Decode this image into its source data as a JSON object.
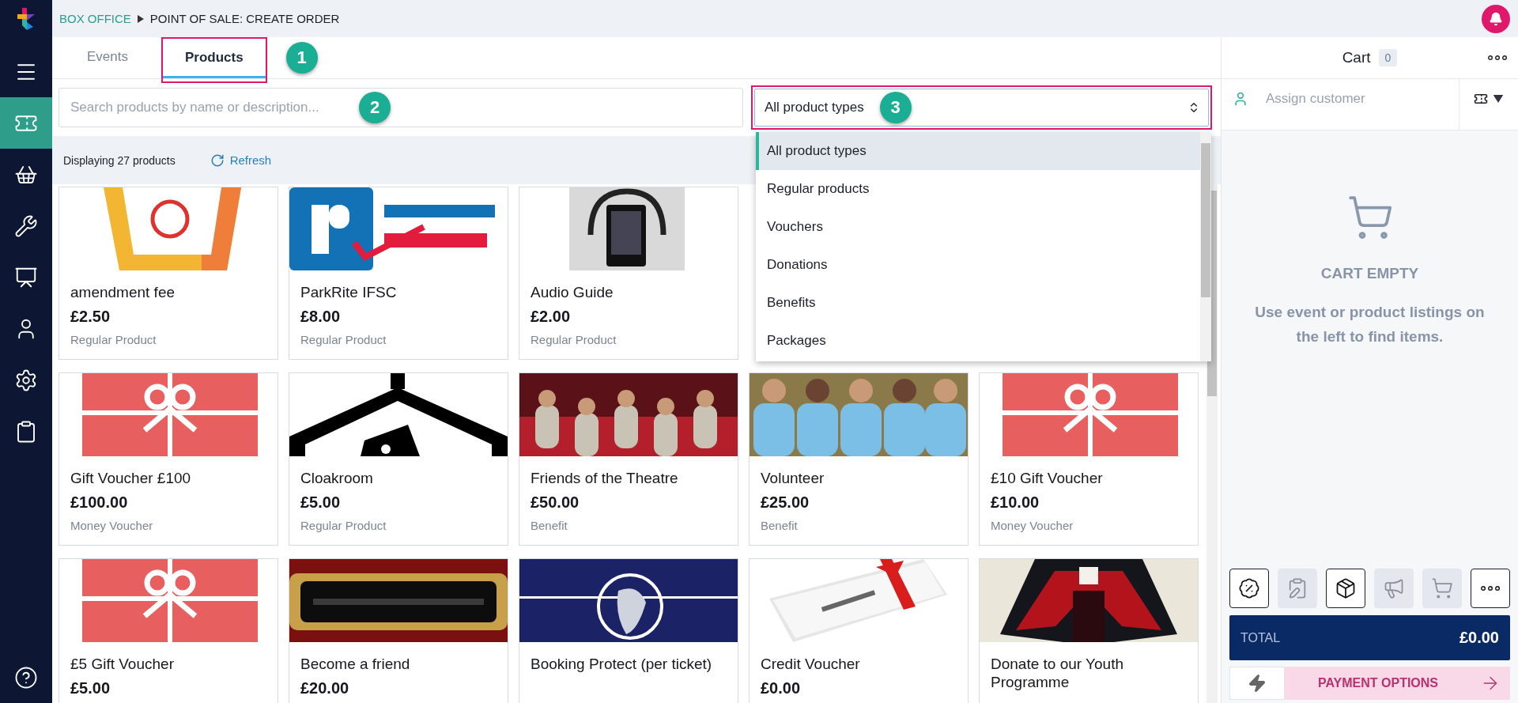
{
  "breadcrumb": {
    "section": "BOX OFFICE",
    "page": "POINT OF SALE: CREATE ORDER"
  },
  "sidebar": {
    "items": [
      {
        "selected": false
      },
      {
        "selected": true
      },
      {
        "selected": false
      },
      {
        "selected": false
      },
      {
        "selected": false
      },
      {
        "selected": false
      },
      {
        "selected": false
      },
      {
        "selected": false
      }
    ]
  },
  "tabs": [
    {
      "label": "Events",
      "selected": false
    },
    {
      "label": "Products",
      "selected": true,
      "annotation": "1"
    }
  ],
  "search": {
    "placeholder": "Search products by name or description...",
    "annotation": "2"
  },
  "type_filter": {
    "value": "All product types",
    "annotation": "3",
    "expanded": true,
    "options": [
      {
        "label": "All product types",
        "selected": true
      },
      {
        "label": "Regular products",
        "selected": false
      },
      {
        "label": "Vouchers",
        "selected": false
      },
      {
        "label": "Donations",
        "selected": false
      },
      {
        "label": "Benefits",
        "selected": false
      },
      {
        "label": "Packages",
        "selected": false
      }
    ]
  },
  "status": {
    "count": "Displaying 27 products",
    "refresh": "Refresh"
  },
  "product_rows": [
    [
      {
        "name": "amendment fee",
        "price": "£2.50",
        "type": "Regular Product"
      },
      {
        "name": "ParkRite IFSC",
        "price": "£8.00",
        "type": "Regular Product"
      },
      {
        "name": "Audio Guide",
        "price": "£2.00",
        "type": "Regular Product"
      }
    ],
    [
      {
        "name": "Gift Voucher £100",
        "price": "£100.00",
        "type": "Money Voucher"
      },
      {
        "name": "Cloakroom",
        "price": "£5.00",
        "type": "Regular Product"
      },
      {
        "name": "Friends of the Theatre",
        "price": "£50.00",
        "type": "Benefit"
      },
      {
        "name": "Volunteer",
        "price": "£25.00",
        "type": "Benefit"
      },
      {
        "name": "£10 Gift Voucher",
        "price": "£10.00",
        "type": "Money Voucher"
      }
    ],
    [
      {
        "name": "£5 Gift Voucher",
        "price": "£5.00"
      },
      {
        "name": "Become a friend",
        "price": "£20.00"
      },
      {
        "name": "Booking Protect (per ticket)"
      },
      {
        "name": "Credit Voucher",
        "price": "£0.00"
      },
      {
        "name": "Donate to our Youth Programme"
      }
    ]
  ],
  "cart": {
    "title": "Cart",
    "count": "0",
    "customer_placeholder": "Assign customer",
    "empty_title": "CART EMPTY",
    "empty_text": "Use event or product listings on the left to find items.",
    "actions": [
      {
        "disabled": false
      },
      {
        "disabled": true
      },
      {
        "disabled": false
      },
      {
        "disabled": true
      },
      {
        "disabled": true
      },
      {
        "disabled": false
      }
    ],
    "total_label": "TOTAL",
    "total": "£0.00",
    "payment": {
      "label": "PAYMENT OPTIONS",
      "disabled": true
    }
  }
}
